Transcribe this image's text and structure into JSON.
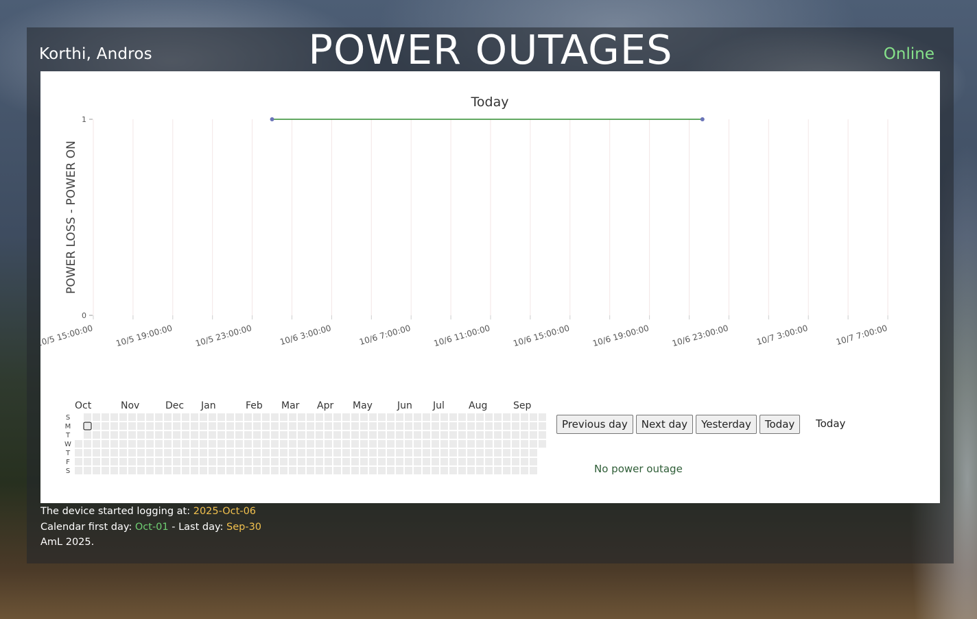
{
  "header": {
    "location": "Korthi, Andros",
    "title": "POWER OUTAGES",
    "status": "Online",
    "status_color": "#86e28a"
  },
  "chart_data": {
    "type": "line",
    "title": "Today",
    "ylabel": "POWER LOSS   -   POWER ON",
    "ylim": [
      0,
      1
    ],
    "y_ticks": [
      "0",
      "1"
    ],
    "x_ticks": [
      "10/5 15:00:00",
      "10/5 19:00:00",
      "10/5 23:00:00",
      "10/6 3:00:00",
      "10/6 7:00:00",
      "10/6 11:00:00",
      "10/6 15:00:00",
      "10/6 19:00:00",
      "10/6 23:00:00",
      "10/7 3:00:00",
      "10/7 7:00:00"
    ],
    "x_range": [
      "2025-10-05 15:00",
      "2025-10-07 07:00"
    ],
    "series": [
      {
        "points": [
          {
            "x": "2025-10-06 00:00",
            "y": 1
          },
          {
            "x": "2025-10-06 21:40",
            "y": 1
          }
        ],
        "color": "#2e8b2e",
        "marker_color": "#6a74b8"
      }
    ],
    "grid": true
  },
  "calendar": {
    "months": [
      "Oct",
      "Nov",
      "Dec",
      "Jan",
      "Feb",
      "Mar",
      "Apr",
      "May",
      "Jun",
      "Jul",
      "Aug",
      "Sep"
    ],
    "weekdays": [
      "S",
      "M",
      "T",
      "W",
      "T",
      "F",
      "S"
    ],
    "highlighted_day": "2025-10-06"
  },
  "controls": {
    "prev_day": "Previous day",
    "next_day": "Next day",
    "yesterday": "Yesterday",
    "today": "Today",
    "selected_label": "Today"
  },
  "summary": {
    "message": "No power outage"
  },
  "footer": {
    "logging_label": "The device started logging at: ",
    "logging_date": "2025-Oct-06",
    "calendar_label": "Calendar first day: ",
    "first_day": "Oct-01",
    "last_day_label": " - Last day: ",
    "last_day": "Sep-30",
    "copyright": "AmL 2025."
  }
}
